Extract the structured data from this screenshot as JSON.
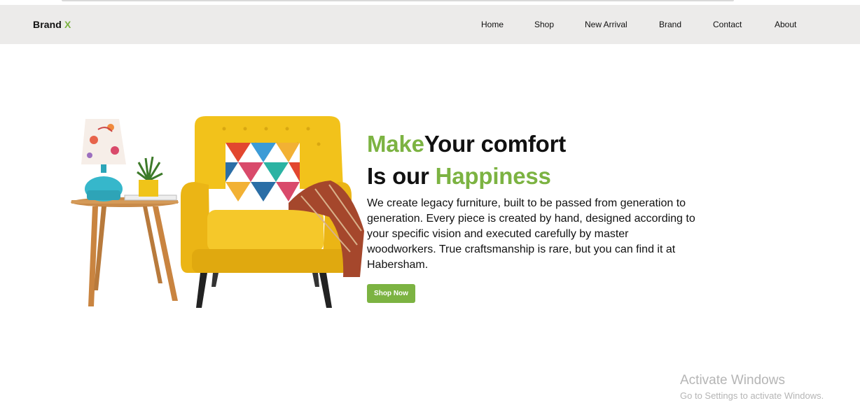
{
  "brand": {
    "name": "Brand",
    "mark": "X"
  },
  "nav": {
    "home": "Home",
    "shop": "Shop",
    "new_arrival": "New Arrival",
    "brand": "Brand",
    "contact": "Contact",
    "about": "About"
  },
  "hero": {
    "line1_accent": "Make",
    "line1_rest": "Your comfort",
    "line2_lead": "Is our ",
    "line2_accent": "Happiness",
    "description": "We create legacy furniture, built to be passed from generation to generation. Every piece is created by hand, designed according to your specific vision and executed carefully by master woodworkers. True craftsmanship is rare, but you can find it at Habersham.",
    "cta": "Shop Now"
  },
  "watermark": {
    "title": "Activate Windows",
    "subtitle": "Go to Settings to activate Windows."
  },
  "colors": {
    "accent": "#7cb342",
    "nav_bg": "#ecebea",
    "chair": "#f2c21b"
  }
}
